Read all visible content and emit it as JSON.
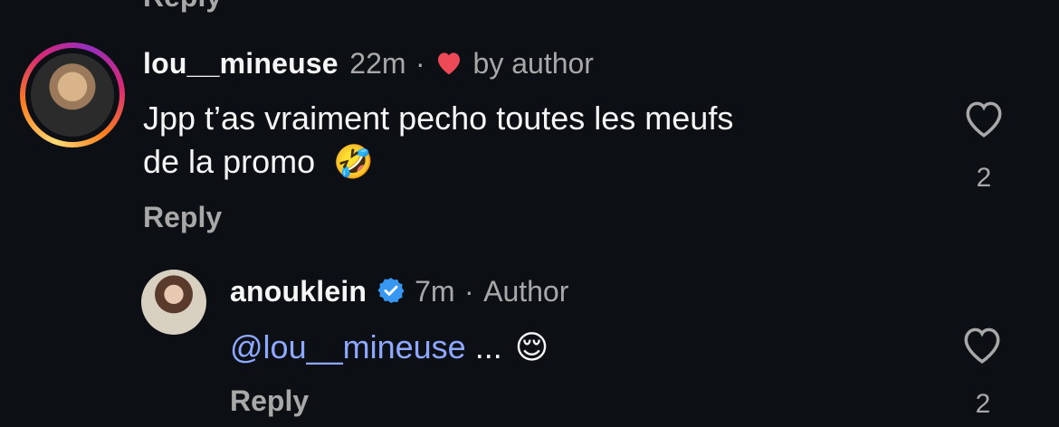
{
  "top_partial": {
    "reply_label": "Reply"
  },
  "comments": [
    {
      "username": "lou__mineuse",
      "time": "22m",
      "separator": "·",
      "liked_by": "by author",
      "text_line1": "Jpp t’as vraiment pecho toutes les meufs",
      "text_line2": "de la promo",
      "emoji": "🤣",
      "reply_label": "Reply",
      "like_count": "2"
    },
    {
      "username": "anouklein",
      "verified": true,
      "time": "7m",
      "separator": "·",
      "role": "Author",
      "mention": "@lou__mineuse",
      "text_after": " ...",
      "emoji": "😌",
      "reply_label": "Reply",
      "like_count": "2"
    }
  ],
  "colors": {
    "background": "#0c0f14",
    "heart_red": "#ed4956",
    "verified_blue": "#3897f0",
    "mention_blue": "#8fa8ff"
  }
}
